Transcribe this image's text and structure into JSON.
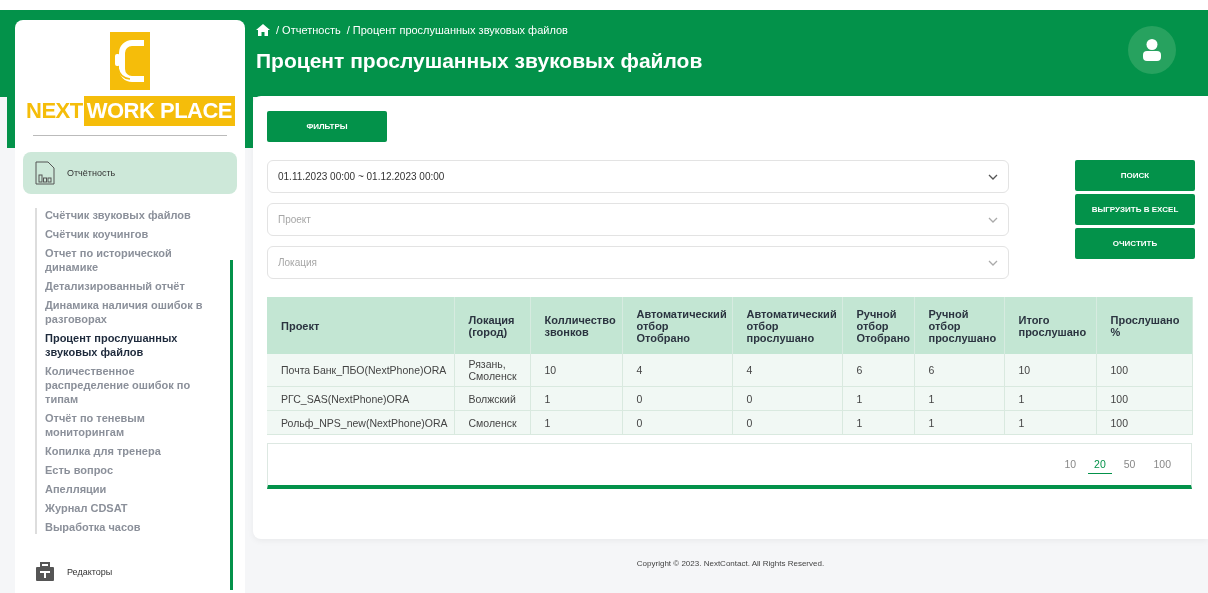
{
  "logo": {
    "first": "NEXT",
    "second": "WORK PLACE"
  },
  "sidebar": {
    "sections": [
      {
        "label": "Отчётность",
        "kind": "report",
        "selected": true,
        "children": [
          {
            "label": "Счётчик звуковых файлов",
            "selected": false
          },
          {
            "label": "Счётчик коучингов",
            "selected": false
          },
          {
            "label": "Отчет по исторической динамике",
            "selected": false
          },
          {
            "label": "Детализированный отчёт",
            "selected": false
          },
          {
            "label": "Динамика наличия ошибок в разговорах",
            "selected": false
          },
          {
            "label": "Процент прослушанных звуковых файлов",
            "selected": true
          },
          {
            "label": "Количественное распределение ошибок по типам",
            "selected": false
          },
          {
            "label": "Отчёт по теневым мониторингам",
            "selected": false
          },
          {
            "label": "Копилка для тренера",
            "selected": false
          },
          {
            "label": "Есть вопрос",
            "selected": false
          },
          {
            "label": "Апелляции",
            "selected": false
          },
          {
            "label": "Журнал CDSAT",
            "selected": false
          },
          {
            "label": "Выработка часов",
            "selected": false
          }
        ]
      },
      {
        "label": "Редакторы",
        "kind": "editor",
        "selected": false
      }
    ]
  },
  "breadcrumb": [
    "/ Отчетность",
    "/ Процент прослушанных звуковых файлов"
  ],
  "title": "Процент прослушанных звуковых файлов",
  "filters_button": "ФИЛЬТРЫ",
  "selects": [
    {
      "value": "01.11.2023 00:00 ~ 01.12.2023 00:00"
    },
    {
      "placeholder": "Проект"
    },
    {
      "placeholder": "Локация"
    }
  ],
  "actions": [
    "ПОИСК",
    "ВЫГРУЗИТЬ В EXCEL",
    "ОЧИСТИТЬ"
  ],
  "table": {
    "columns": [
      "Проект",
      "Локация (город)",
      "Колличество звонков",
      "Автоматический отбор Отобрано",
      "Автоматический отбор прослушано",
      "Ручной отбор Отобрано",
      "Ручной отбор прослушано",
      "Итого прослушано",
      "Прослушано %"
    ],
    "rows": [
      [
        "Почта Банк_ПБО(NextPhone)ORA",
        "Рязань, Смоленск",
        "10",
        "4",
        "4",
        "6",
        "6",
        "10",
        "100"
      ],
      [
        "РГС_SAS(NextPhone)ORA",
        "Волжский",
        "1",
        "0",
        "0",
        "1",
        "1",
        "1",
        "100"
      ],
      [
        "Рольф_NPS_new(NextPhone)ORA",
        "Смоленск",
        "1",
        "0",
        "0",
        "1",
        "1",
        "1",
        "100"
      ]
    ]
  },
  "page_sizes": [
    {
      "label": "10",
      "selected": false
    },
    {
      "label": "20",
      "selected": true
    },
    {
      "label": "50",
      "selected": false
    },
    {
      "label": "100",
      "selected": false
    }
  ],
  "footer": "Copyright © 2023. NextContact. All Rights Reserved."
}
